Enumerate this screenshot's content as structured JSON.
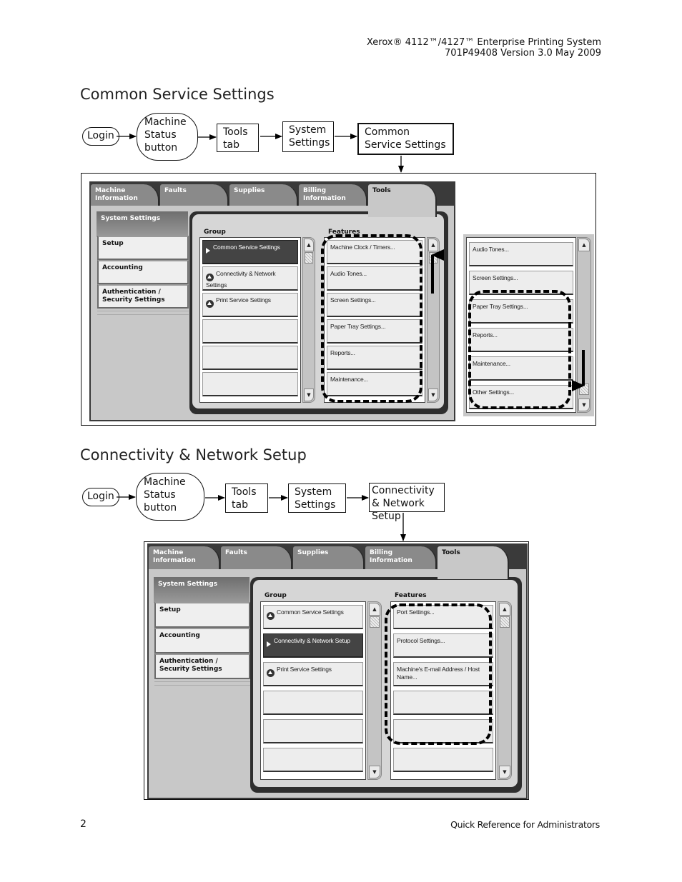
{
  "header": {
    "line1": "Xerox® 4112™/4127™ Enterprise Printing System",
    "line2": "701P49408 Version 3.0 May 2009"
  },
  "sections": [
    {
      "title": "Common Service Settings",
      "flow": [
        "Login",
        "Machine Status button",
        "Tools tab",
        "System Settings",
        "Common Service Settings"
      ],
      "screen": {
        "tabs": [
          "Machine Information",
          "Faults",
          "Supplies",
          "Billing Information",
          "Tools"
        ],
        "active_tab": "Tools",
        "sidebar_header": "System Settings",
        "sidebar_items": [
          "Setup",
          "Accounting",
          "Authentication / Security Settings"
        ],
        "group_label": "Group",
        "features_label": "Features",
        "group_items": [
          "Common Service Settings",
          "Connectivity & Network Settings",
          "Print Service Settings",
          "",
          "",
          ""
        ],
        "group_selected": 0,
        "feature_items": [
          "Machine Clock / Timers...",
          "Audio Tones...",
          "Screen  Settings...",
          "Paper Tray Settings...",
          "Reports...",
          "Maintenance..."
        ]
      },
      "scrolled_list": {
        "items": [
          "Audio Tones...",
          "Screen Settings...",
          "Paper Tray Settings...",
          "Reports...",
          "Maintenance...",
          "Other Settings..."
        ]
      }
    },
    {
      "title": "Connectivity & Network Setup",
      "flow": [
        "Login",
        "Machine Status button",
        "Tools tab",
        "System Settings",
        "Connectivity & Network Setup"
      ],
      "screen": {
        "tabs": [
          "Machine Information",
          "Faults",
          "Supplies",
          "Billing Information",
          "Tools"
        ],
        "active_tab": "Tools",
        "sidebar_header": "System Settings",
        "sidebar_items": [
          "Setup",
          "Accounting",
          "Authentication / Security Settings"
        ],
        "group_label": "Group",
        "features_label": "Features",
        "group_items": [
          "Common Service Settings",
          "Connectivity & Network Setup",
          "Print Service Settings",
          "",
          "",
          ""
        ],
        "group_selected": 1,
        "feature_items": [
          "Port Settings...",
          "Protocol Settings...",
          "Machine's E-mail Address / Host Name...",
          "",
          "",
          ""
        ]
      }
    }
  ],
  "footer": {
    "page_number": "2",
    "doc_title": "Quick Reference for Administrators"
  }
}
